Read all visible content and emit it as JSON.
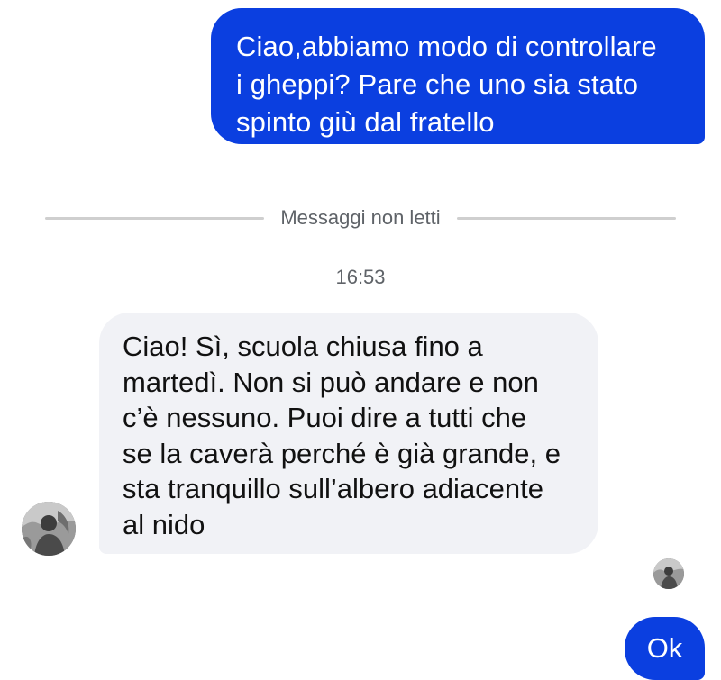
{
  "messages": {
    "sent_first": {
      "lines": [
        "Ciao,abbiamo modo di controllare",
        "i gheppi? Pare che uno sia stato",
        "spinto giù dal fratello"
      ]
    },
    "unread_divider_label": "Messaggi non letti",
    "timestamp": "16:53",
    "received": {
      "lines": [
        "Ciao! Sì, scuola chiusa fino a",
        "martedì. Non si può andare e non",
        "c’è nessuno. Puoi dire a tutti che",
        "se la caverà perché è già grande, e",
        "sta tranquillo sull’albero adiacente",
        "al nido"
      ]
    },
    "sent_last": {
      "text": "Ok"
    }
  },
  "colors": {
    "sent_bubble": "#0b3fe0",
    "received_bubble": "#f1f2f6",
    "meta_text": "#5f6368"
  },
  "icons": {
    "contact_avatar": "contact-avatar-photo",
    "read_receipt": "read-receipt-avatar"
  }
}
